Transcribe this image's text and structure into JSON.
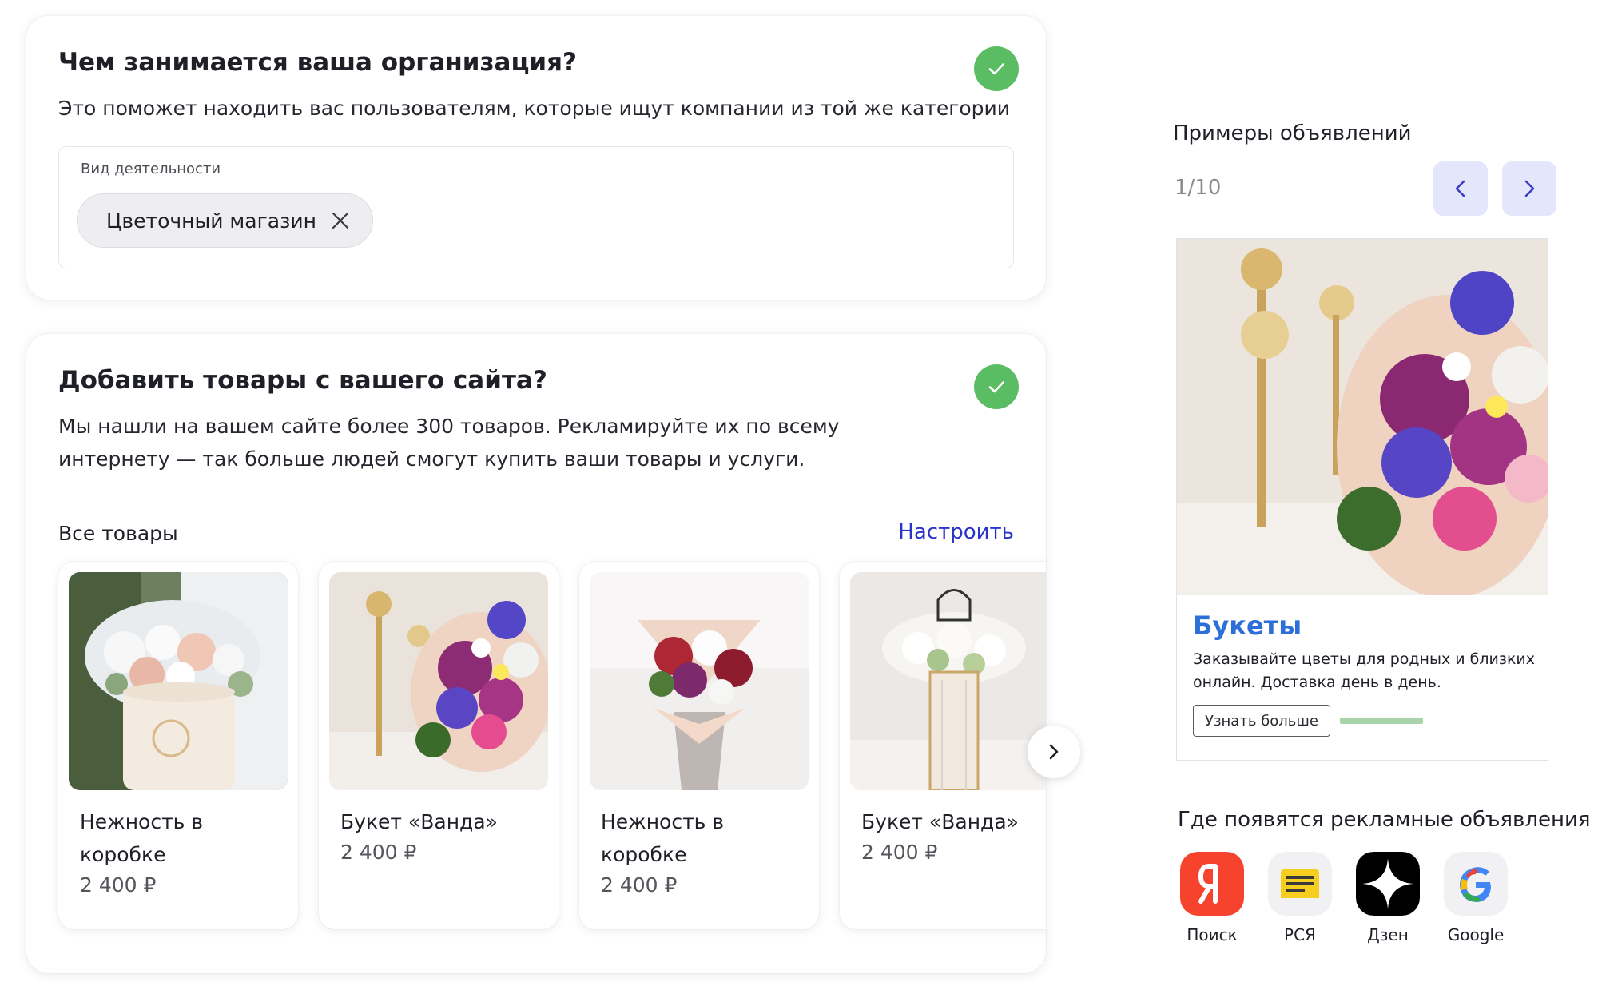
{
  "org_card": {
    "title": "Чем занимается ваша организация?",
    "description": "Это поможет находить вас пользователям, которые ищут компании из той же категории",
    "field_label": "Вид деятельности",
    "chip_value": "Цветочный магазин",
    "status_icon": "check-icon",
    "status_color": "#5bbd63"
  },
  "goods_card": {
    "title": "Добавить товары с вашего сайта?",
    "description_line1": "Мы нашли на вашем сайте более 300 товаров. Рекламируйте их по всему",
    "description_line2": "интернету — так больше людей смогут купить ваши товары и услуги.",
    "section_label": "Все товары",
    "settings_link": "Настроить",
    "link_color": "#2b34c9",
    "products": [
      {
        "name": "Нежность в коробке",
        "price": "2 400 ₽"
      },
      {
        "name": "Букет «Ванда»",
        "price": "2 400 ₽"
      },
      {
        "name": "Нежность в коробке",
        "price": "2 400 ₽"
      },
      {
        "name": "Букет «Ванда»",
        "price": "2 400 ₽"
      }
    ]
  },
  "examples": {
    "title": "Примеры объявлений",
    "counter": "1/10",
    "ad": {
      "title": "Букеты",
      "text": "Заказывайте цветы для родных и близких онлайн. Доставка день в день.",
      "button": "Узнать больше"
    }
  },
  "placements": {
    "title": "Где появятся рекламные объявления",
    "items": [
      {
        "label": "Поиск",
        "icon": "yandex-search-icon"
      },
      {
        "label": "РСЯ",
        "icon": "rsya-icon"
      },
      {
        "label": "Дзен",
        "icon": "dzen-icon"
      },
      {
        "label": "Google",
        "icon": "google-icon"
      }
    ]
  }
}
